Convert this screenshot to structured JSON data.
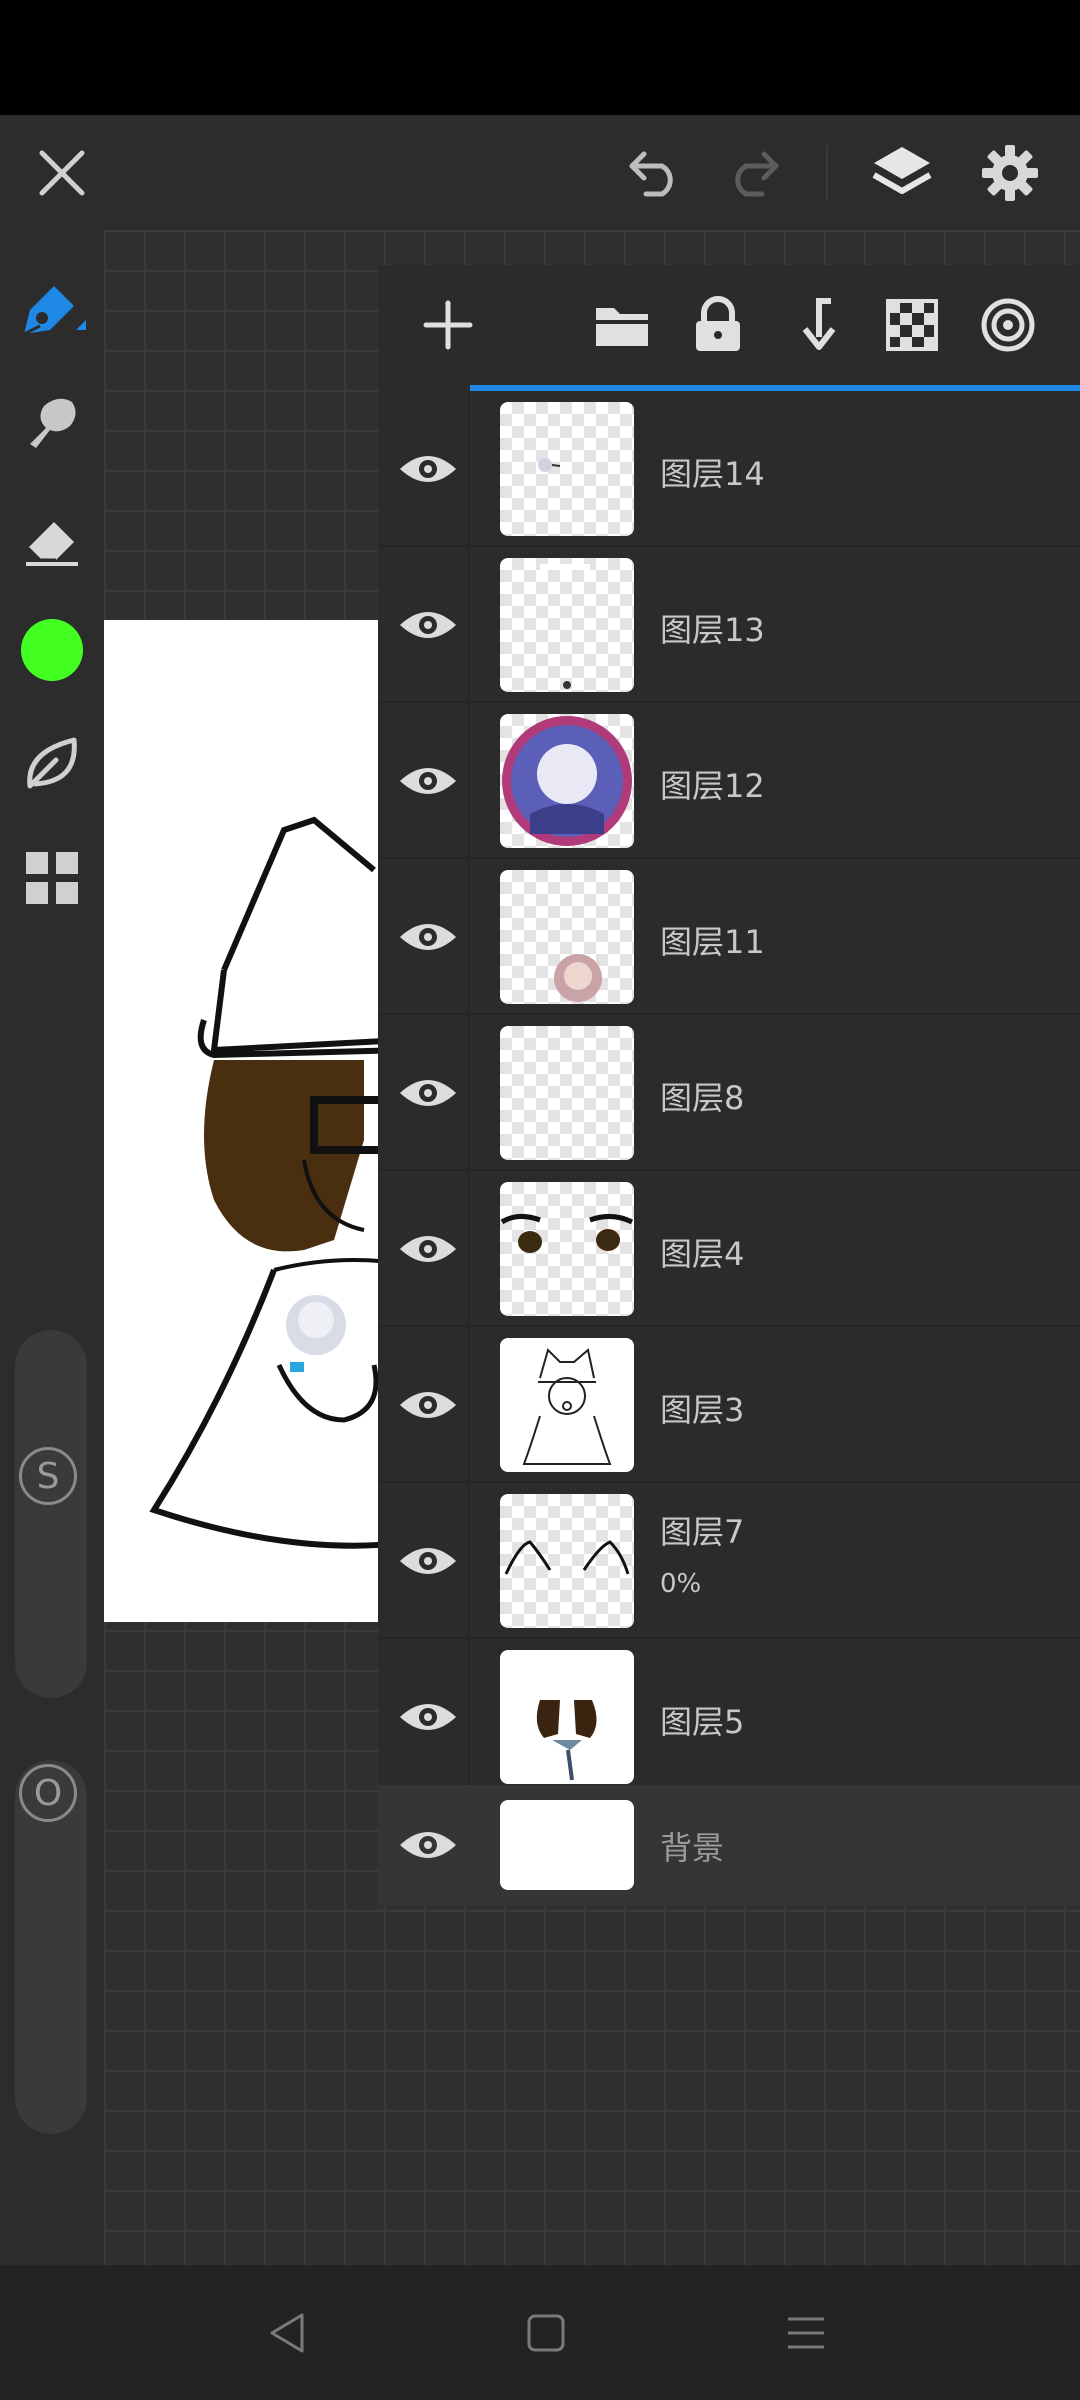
{
  "app": {
    "accent_color": "#1e88e5",
    "current_color": "#44ff22",
    "top_toolbar": {
      "icons": [
        "close-icon",
        "undo-icon",
        "redo-icon",
        "layers-icon",
        "settings-icon"
      ]
    },
    "sidebar": {
      "tools": [
        "pen-icon",
        "smudge-icon",
        "eraser-icon",
        "color-swatch",
        "leaf-icon",
        "grid-icon"
      ],
      "size_slider_label": "S",
      "opacity_slider_label": "O"
    },
    "layer_panel": {
      "toolbar_icons": [
        "add-icon",
        "folder-icon",
        "lock-icon",
        "merge-down-icon",
        "transparency-icon",
        "blend-mode-icon"
      ],
      "layers": [
        {
          "name": "图层14",
          "opacity": ""
        },
        {
          "name": "图层13",
          "opacity": ""
        },
        {
          "name": "图层12",
          "opacity": ""
        },
        {
          "name": "图层11",
          "opacity": ""
        },
        {
          "name": "图层8",
          "opacity": ""
        },
        {
          "name": "图层4",
          "opacity": ""
        },
        {
          "name": "图层3",
          "opacity": ""
        },
        {
          "name": "图层7",
          "opacity": "0%"
        },
        {
          "name": "图层5",
          "opacity": ""
        }
      ],
      "background_layer": {
        "name": "背景"
      }
    },
    "navbar": {
      "icons": [
        "back-icon",
        "home-icon",
        "menu-icon"
      ]
    }
  }
}
